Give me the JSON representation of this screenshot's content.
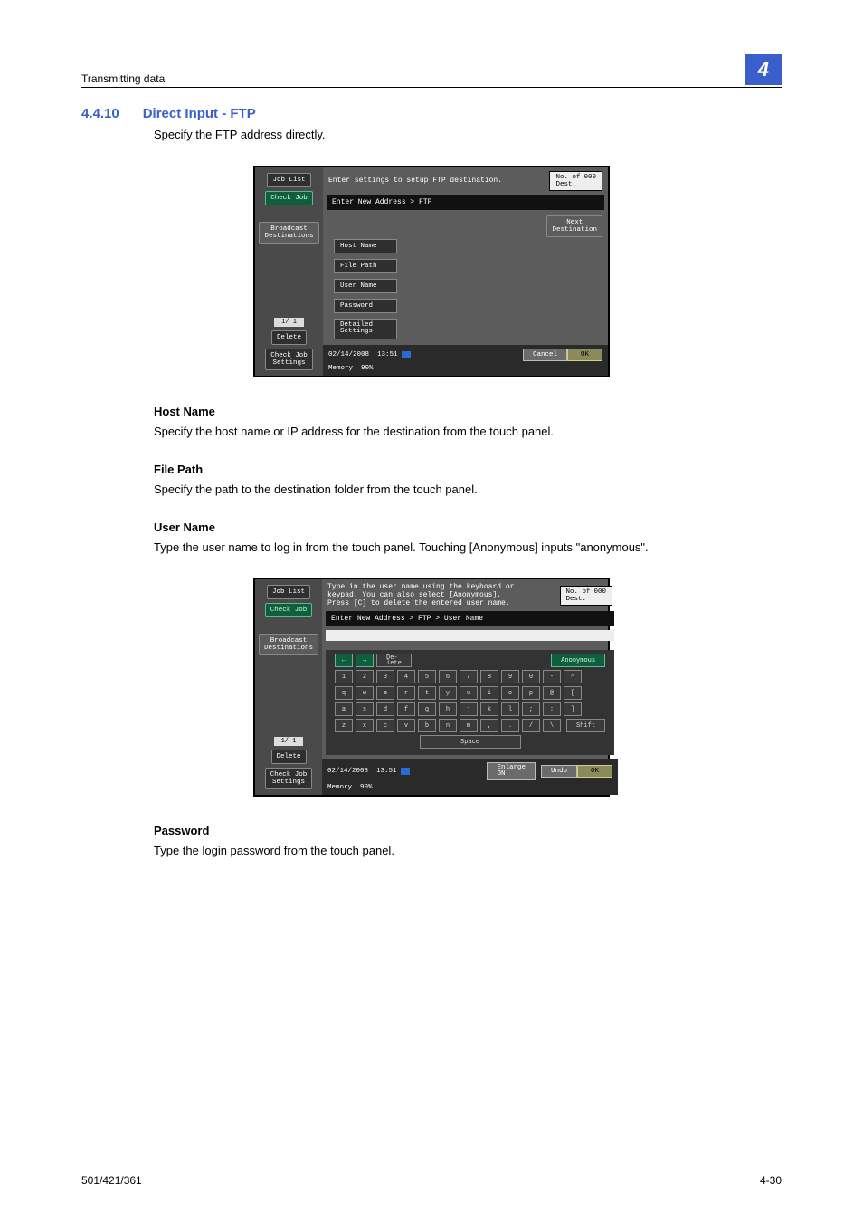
{
  "page": {
    "running_head": "Transmitting data",
    "chapter_number": "4",
    "footer_left": "501/421/361",
    "footer_right": "4-30"
  },
  "section": {
    "number": "4.4.10",
    "title": "Direct Input - FTP",
    "intro": "Specify the FTP address directly."
  },
  "subsections": {
    "hostname": {
      "heading": "Host Name",
      "text": "Specify the host name or IP address for the destination from the touch panel."
    },
    "filepath": {
      "heading": "File Path",
      "text": "Specify the path to the destination folder from the touch panel."
    },
    "username": {
      "heading": "User Name",
      "text": "Type the user name to log in from the touch panel. Touching [Anonymous] inputs \"anonymous\"."
    },
    "password": {
      "heading": "Password",
      "text": "Type the login password from the touch panel."
    }
  },
  "screen_common": {
    "left": {
      "job_list": "Job List",
      "check_job": "Check Job",
      "broadcast_destinations": "Broadcast\nDestinations",
      "page_indicator": "1/ 1",
      "delete": "Delete",
      "check_job_settings": "Check Job\nSettings"
    },
    "footer": {
      "date": "02/14/2008",
      "time": "13:51",
      "memory_label": "Memory",
      "memory_value": "90%",
      "cancel": "Cancel",
      "ok": "OK",
      "undo": "Undo",
      "enlarge": "Enlarge\nON"
    },
    "dest_count_label": "No. of\nDest.",
    "dest_count_value": "000"
  },
  "screen1": {
    "instruction": "Enter settings to setup FTP destination.",
    "breadcrumb": "Enter New Address > FTP",
    "next_destination": "Next\nDestination",
    "fields": {
      "host_name": "Host Name",
      "file_path": "File Path",
      "user_name": "User Name",
      "password": "Password",
      "detailed_settings": "Detailed\nSettings"
    }
  },
  "screen2": {
    "instruction_l1": "Type in the user name using the keyboard or",
    "instruction_l2": "keypad. You can also select [Anonymous].",
    "instruction_l3": "Press [C] to delete the entered user name.",
    "breadcrumb": "Enter New Address > FTP > User Name",
    "buttons": {
      "left_arrow": "←",
      "right_arrow": "→",
      "delete_key": "De-\nlete",
      "anonymous": "Anonymous",
      "shift": "Shift",
      "space": "Space"
    },
    "rows": {
      "r1": [
        "1",
        "2",
        "3",
        "4",
        "5",
        "6",
        "7",
        "8",
        "9",
        "0",
        "-",
        "^"
      ],
      "r2": [
        "q",
        "w",
        "e",
        "r",
        "t",
        "y",
        "u",
        "i",
        "o",
        "p",
        "@",
        "["
      ],
      "r3": [
        "a",
        "s",
        "d",
        "f",
        "g",
        "h",
        "j",
        "k",
        "l",
        ";",
        ":",
        "]"
      ],
      "r4": [
        "z",
        "x",
        "c",
        "v",
        "b",
        "n",
        "m",
        ",",
        ".",
        "/",
        "\\"
      ]
    }
  }
}
